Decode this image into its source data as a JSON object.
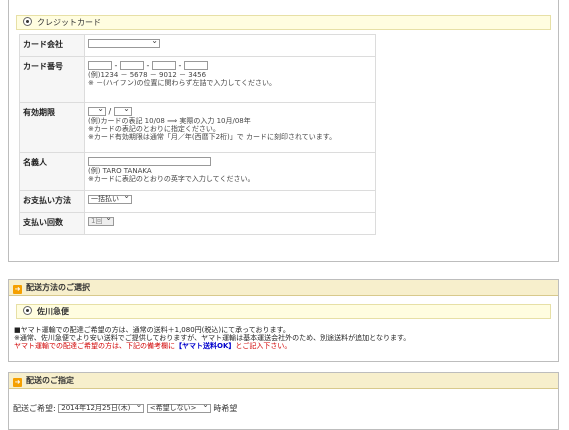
{
  "credit_card": {
    "option_label": "クレジットカード",
    "card_company": {
      "label": "カード会社",
      "selected": ""
    },
    "card_number": {
      "label": "カード番号",
      "separator": "-",
      "example": "(例)1234 － 5678 － 9012 － 3456",
      "note": "※ －(ハイフン)の位置に関わらず左詰で入力してください。"
    },
    "expiry": {
      "label": "有効期限",
      "slash": "/",
      "example": "(例)カードの表記 10/08 ⟹ 実際の入力 10月/08年",
      "note1": "※カードの表記のとおりに指定ください。",
      "note2": "※カード有効期限は通常「月／年(西暦下2桁)」で カードに刻印されています。"
    },
    "holder": {
      "label": "名義人",
      "example": "(例) TARO TANAKA",
      "note": "※カードに表記のとおりの英字で入力してください。"
    },
    "payment_method": {
      "label": "お支払い方法",
      "selected": "一括払い"
    },
    "installments": {
      "label": "支払い回数",
      "selected": "1回"
    }
  },
  "shipping": {
    "title": "配送方法のご選択",
    "option_label": "佐川急便",
    "line1": "■ヤマト運輸での配達ご希望の方は、通常の送料＋1,080円(税込)にて承っております。",
    "line2": "※通常、佐川急便でより安い送料でご提供しておりますが、ヤマト運輸は基本運送会社外のため、別途送料が追加となります。",
    "line3_prefix": "ヤマト運輸での配達ご希望の方は、下記の備考欄に",
    "line3_highlight": "【ヤマト送料OK】",
    "line3_suffix": "とご記入下さい。"
  },
  "delivery_date": {
    "title": "配送のご指定",
    "label": "配送ご希望:",
    "date_value": "2014年12月25日(木)",
    "time_value": "<希望しない>",
    "suffix": "時希望"
  }
}
